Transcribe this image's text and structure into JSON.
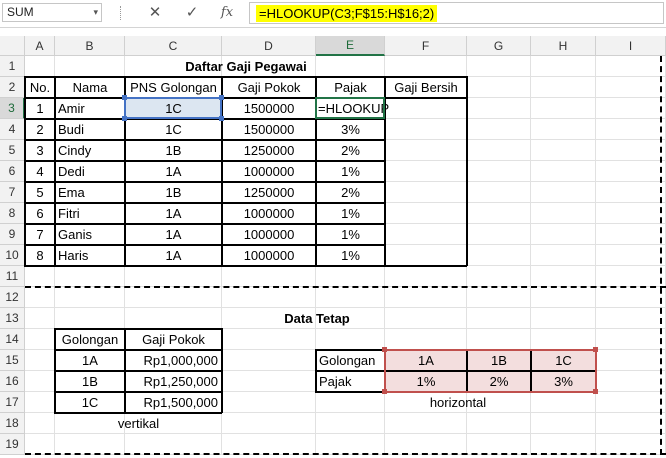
{
  "namebox": "SUM",
  "formula_icons": [
    "cancel-icon",
    "confirm-icon",
    "function-icon"
  ],
  "fx_label": "fx",
  "formula": "=HLOOKUP(C3;F$15:H$16;2)",
  "columns": [
    "A",
    "B",
    "C",
    "D",
    "E",
    "F",
    "G",
    "H",
    "I"
  ],
  "rows": [
    "1",
    "2",
    "3",
    "4",
    "5",
    "6",
    "7",
    "8",
    "9",
    "10",
    "11",
    "12",
    "13",
    "14",
    "15",
    "16",
    "17",
    "18",
    "19"
  ],
  "title_main": "Daftar Gaji Pegawai",
  "headers": {
    "no": "No.",
    "nama": "Nama",
    "golongan": "PNS Golongan",
    "gaji_pokok": "Gaji Pokok",
    "pajak": "Pajak",
    "gaji_bersih": "Gaji Bersih"
  },
  "employees": [
    {
      "no": "1",
      "nama": "Amir",
      "gol": "1C",
      "gaji": "1500000",
      "pajak": "=HLOOKUP"
    },
    {
      "no": "2",
      "nama": "Budi",
      "gol": "1C",
      "gaji": "1500000",
      "pajak": "3%"
    },
    {
      "no": "3",
      "nama": "Cindy",
      "gol": "1B",
      "gaji": "1250000",
      "pajak": "2%"
    },
    {
      "no": "4",
      "nama": "Dedi",
      "gol": "1A",
      "gaji": "1000000",
      "pajak": "1%"
    },
    {
      "no": "5",
      "nama": "Ema",
      "gol": "1B",
      "gaji": "1250000",
      "pajak": "2%"
    },
    {
      "no": "6",
      "nama": "Fitri",
      "gol": "1A",
      "gaji": "1000000",
      "pajak": "1%"
    },
    {
      "no": "7",
      "nama": "Ganis",
      "gol": "1A",
      "gaji": "1000000",
      "pajak": "1%"
    },
    {
      "no": "8",
      "nama": "Haris",
      "gol": "1A",
      "gaji": "1000000",
      "pajak": "1%"
    }
  ],
  "title_tetap": "Data Tetap",
  "vertical": {
    "headers": [
      "Golongan",
      "Gaji Pokok"
    ],
    "rows": [
      [
        "1A",
        "Rp1,000,000"
      ],
      [
        "1B",
        "Rp1,250,000"
      ],
      [
        "1C",
        "Rp1,500,000"
      ]
    ],
    "caption": "vertikal"
  },
  "horizontal": {
    "row1_label": "Golongan",
    "row1": [
      "1A",
      "1B",
      "1C"
    ],
    "row2_label": "Pajak",
    "row2": [
      "1%",
      "2%",
      "3%"
    ],
    "caption": "horizontal"
  },
  "colors": {
    "accent": "#217346",
    "ref_blue": "#4472c4",
    "ref_red": "#c0504d",
    "highlight": "#ffff00"
  }
}
